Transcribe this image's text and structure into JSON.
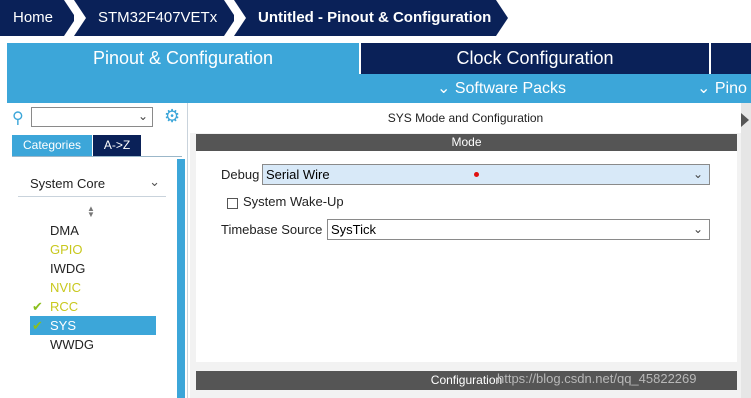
{
  "breadcrumb": {
    "items": [
      "Home",
      "STM32F407VETx",
      "Untitled - Pinout & Configuration"
    ]
  },
  "tabs": {
    "pinout": "Pinout & Configuration",
    "clock": "Clock Configuration",
    "extra": ""
  },
  "subbar": {
    "software_packs": "Software Packs",
    "pinout_partial": "Pino"
  },
  "sidebar": {
    "search_placeholder": "",
    "categories_tab": "Categories",
    "az_tab": "A->Z",
    "group": "System Core",
    "items": [
      {
        "label": "DMA",
        "color": "#222222",
        "checked": false,
        "selected": false
      },
      {
        "label": "GPIO",
        "color": "#c8c81e",
        "checked": false,
        "selected": false
      },
      {
        "label": "IWDG",
        "color": "#222222",
        "checked": false,
        "selected": false
      },
      {
        "label": "NVIC",
        "color": "#c8c81e",
        "checked": false,
        "selected": false
      },
      {
        "label": "RCC",
        "color": "#c8c81e",
        "checked": true,
        "selected": false
      },
      {
        "label": "SYS",
        "color": "#ffffff",
        "checked": true,
        "selected": true
      },
      {
        "label": "WWDG",
        "color": "#222222",
        "checked": false,
        "selected": false
      }
    ]
  },
  "main": {
    "title": "SYS Mode and Configuration",
    "mode_header": "Mode",
    "debug_label": "Debug",
    "debug_value": "Serial Wire",
    "wakeup_label": "System Wake-Up",
    "wakeup_checked": false,
    "timebase_label": "Timebase Source",
    "timebase_value": "SysTick",
    "config_header": "Configuration"
  },
  "watermark": "https://blog.csdn.net/qq_45822269",
  "colors": {
    "navy": "#0a2158",
    "accent_blue": "#3ca6d9",
    "check_green": "#8bbf1e",
    "yellow_item": "#c8c81e",
    "header_gray": "#555555",
    "highlight": "#d8e9f8"
  }
}
